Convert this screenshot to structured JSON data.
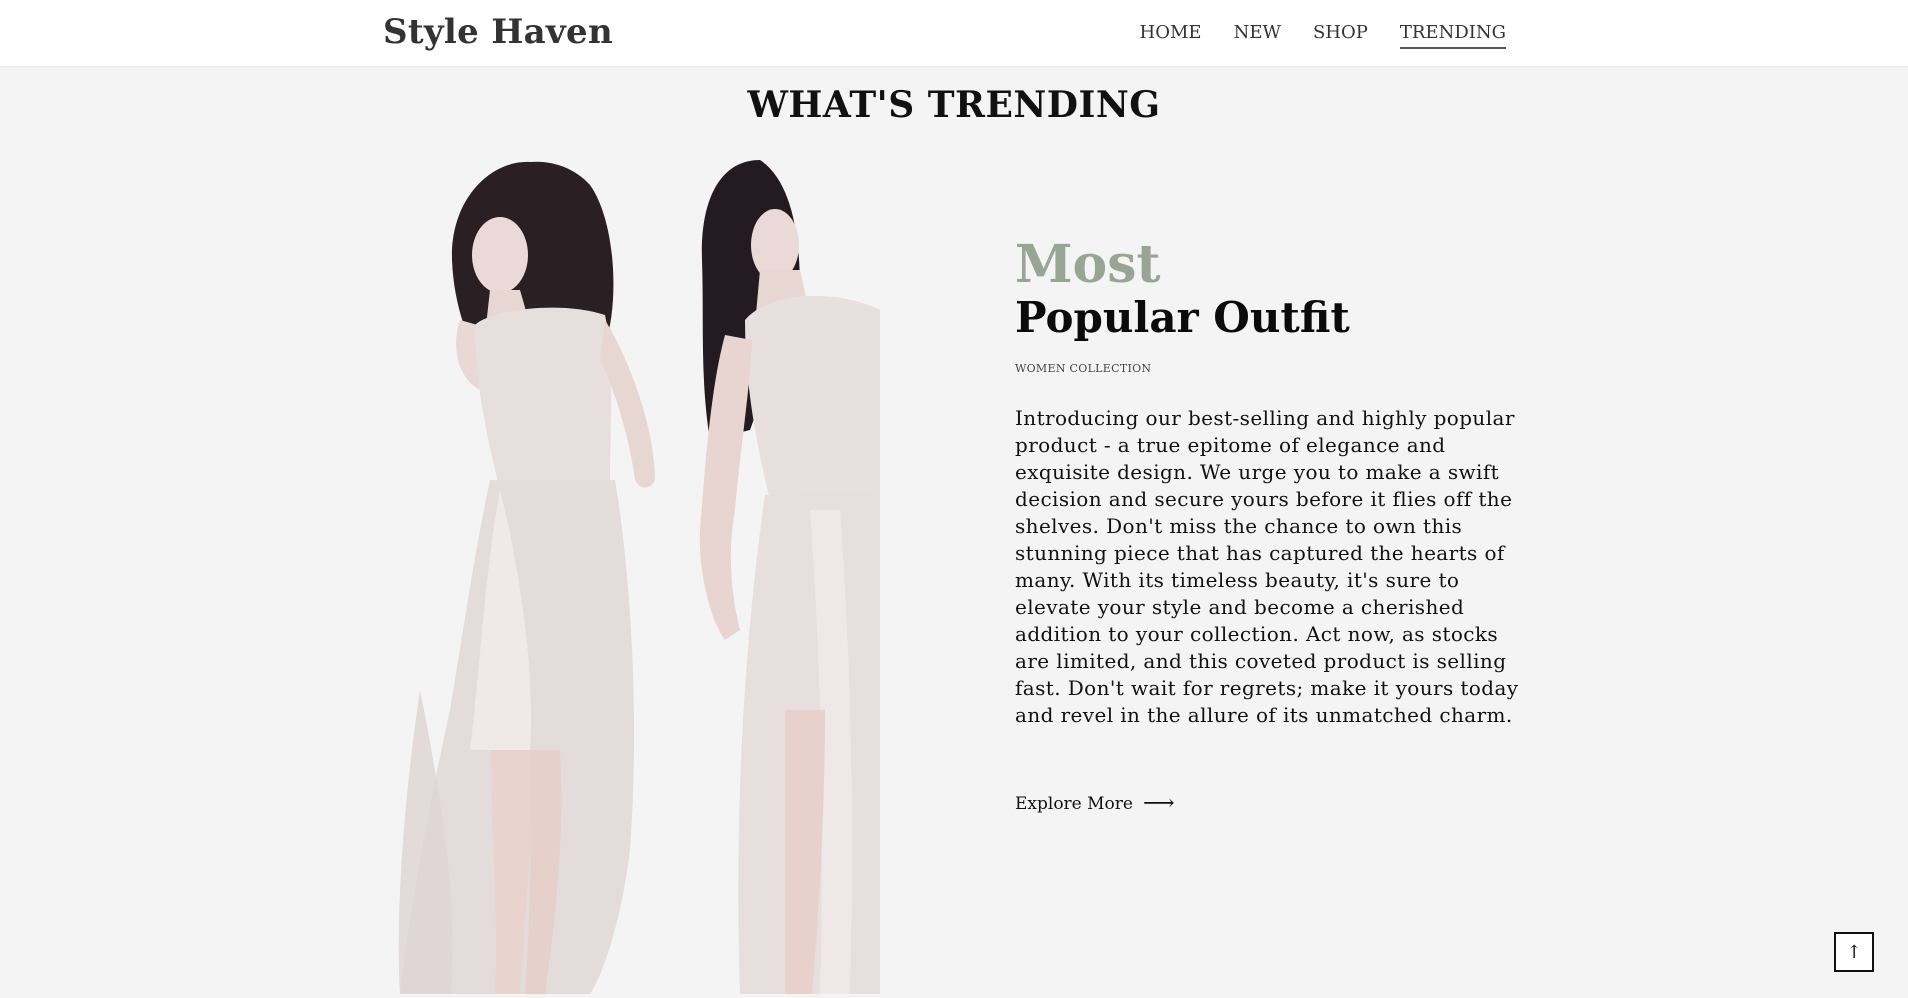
{
  "header": {
    "brand": "Style Haven",
    "nav": [
      "HOME",
      "NEW",
      "SHOP",
      "TRENDING"
    ],
    "active_nav": "TRENDING"
  },
  "section": {
    "title": "WHAT'S TRENDING"
  },
  "feature": {
    "eyebrow": "Most",
    "headline": "Popular Outfit",
    "subhead": "WOMEN COLLECTION",
    "description": "Introducing our best-selling and highly popular product - a true epitome of elegance and exquisite design. We urge you to make a swift decision and secure yours before it flies off the shelves. Don't miss the chance to own this stunning piece that has captured the hearts of many. With its timeless beauty, it's sure to elevate your style and become a cherished addition to your collection. Act now, as stocks are limited, and this coveted product is selling fast. Don't wait for regrets; make it yours today and revel in the allure of its unmatched charm.",
    "cta_label": "Explore More",
    "cta_icon": "arrow-right-icon"
  },
  "back_to_top": {
    "icon": "arrow-up-icon"
  },
  "colors": {
    "background": "#f4f4f4",
    "header_bg": "#ffffff",
    "accent": "#98a594",
    "text": "#111111"
  }
}
